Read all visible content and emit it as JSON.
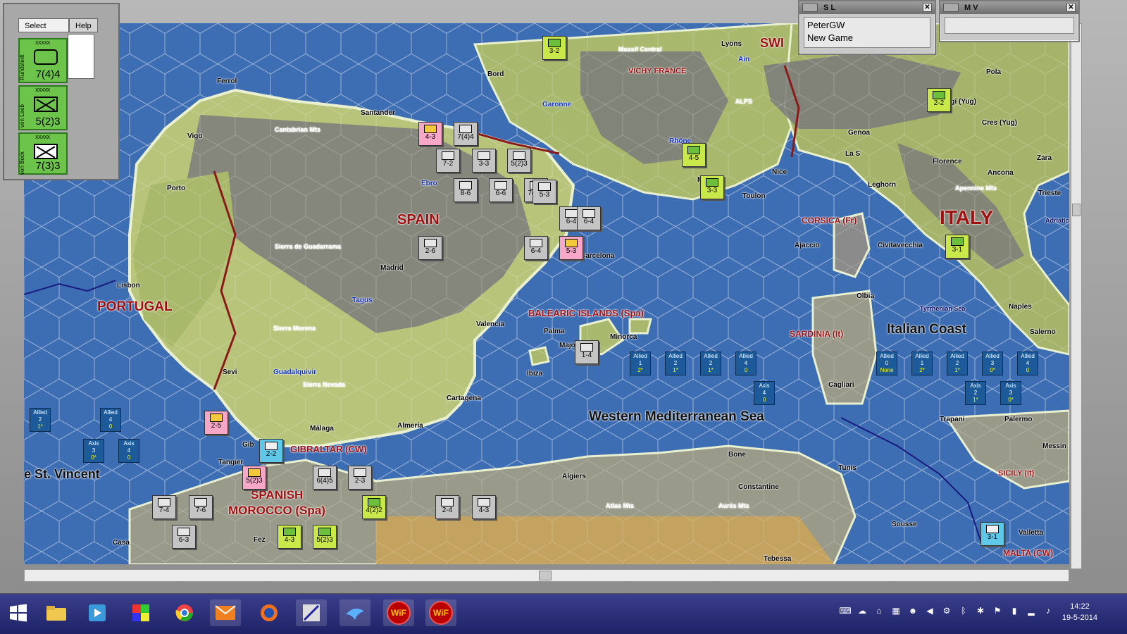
{
  "windows": {
    "select_panel": {
      "tabs": [
        "Select",
        "Help"
      ]
    },
    "sl": {
      "title": "S L",
      "player": "PeterGW",
      "status": "New Game"
    },
    "mv": {
      "title": "M V"
    }
  },
  "hq_cards": [
    {
      "label": "Rundstedt",
      "size": "XXXXX",
      "strength": "7(4)4",
      "symbol": "hq"
    },
    {
      "label": "von Leeb",
      "size": "XXXXX",
      "strength": "5(2)3",
      "symbol": "inf"
    },
    {
      "label": "von Bock",
      "size": "XXXXX",
      "strength": "7(3)3",
      "symbol": "inf"
    }
  ],
  "map": {
    "countries": [
      "SPAIN",
      "PORTUGAL",
      "ITALY",
      "VICHY FRANCE",
      "SWI"
    ],
    "regions": [
      "GIBRALTAR (CW)",
      "SPANISH",
      "MOROCCO (Spa)",
      "BALEARIC ISLANDS (Spa)",
      "CORSICA (Fr)",
      "SARDINIA (It)",
      "SICILY (It)",
      "MALTA (CW)"
    ],
    "seas": [
      "Western Mediterranean Sea",
      "Italian Coast",
      "e St. Vincent",
      "Tyrrhenian Sea",
      "Adriatic"
    ],
    "cities": [
      "Ferrol",
      "Santander",
      "Vigo",
      "Porto",
      "Lisbon",
      "Madrid",
      "Valencia",
      "Sevi",
      "Málaga",
      "Almería",
      "Cartagena",
      "Barcelona",
      "Palma",
      "Majorca",
      "Minorca",
      "Ibiza",
      "Bord",
      "Lyons",
      "Nice",
      "Toulon",
      "Marseill",
      "Genoa",
      "La S",
      "Leghorn",
      "Florence",
      "Ancona",
      "Zara",
      "Civitavecchia",
      "Ajaccio",
      "Olbia",
      "Cagliari",
      "Naples",
      "Salerno",
      "Trapani",
      "Palermo",
      "Messin",
      "Tangier",
      "Algiers",
      "Bone",
      "Constantine",
      "Tunis",
      "Sousse",
      "Tebessa",
      "Casa",
      "Fez",
      "Trieste",
      "Pola",
      "Dugi (Yug)",
      "Cres (Yug)",
      "Gib",
      "Valletta"
    ],
    "terrain": [
      "Cantabrian Mts",
      "Sierra de Guadarrama",
      "Sierra Morena",
      "Sierra Nevada",
      "Massif Central",
      "ALPS",
      "Apennine Mts",
      "Atlas Mts",
      "Aurès Mts"
    ],
    "rivers": [
      "Ebro",
      "Tagus",
      "Guadalquivir",
      "Garonne",
      "Rhône",
      "Ain"
    ],
    "units": [
      {
        "id": "u1",
        "val": "4-3",
        "color": "pink"
      },
      {
        "id": "u2",
        "val": "7(4)4",
        "color": "grey"
      },
      {
        "id": "u3",
        "val": "7-2",
        "color": "grey"
      },
      {
        "id": "u4",
        "val": "3-3",
        "color": "grey"
      },
      {
        "id": "u5",
        "val": "5(2)3",
        "color": "grey"
      },
      {
        "id": "u6",
        "val": "8-6",
        "color": "grey"
      },
      {
        "id": "u7",
        "val": "6-6",
        "color": "grey"
      },
      {
        "id": "u8",
        "val": "7(3)3",
        "color": "grey"
      },
      {
        "id": "u9",
        "val": "2-6",
        "color": "grey"
      },
      {
        "id": "u10",
        "val": "6-4",
        "color": "grey"
      },
      {
        "id": "u11",
        "val": "6-4",
        "color": "grey"
      },
      {
        "id": "u12",
        "val": "6-4",
        "color": "grey"
      },
      {
        "id": "u13",
        "val": "5-3",
        "color": "pink"
      },
      {
        "id": "u14",
        "val": "1-4",
        "color": "grey"
      },
      {
        "id": "u15",
        "val": "2-5",
        "color": "pink"
      },
      {
        "id": "u16",
        "val": "2-2",
        "color": "cyan"
      },
      {
        "id": "u17",
        "val": "5(2)3",
        "color": "pink"
      },
      {
        "id": "u18",
        "val": "6(4)5",
        "color": "grey"
      },
      {
        "id": "u19",
        "val": "2-3",
        "color": "grey"
      },
      {
        "id": "u20",
        "val": "7-4",
        "color": "grey"
      },
      {
        "id": "u21",
        "val": "7-6",
        "color": "grey"
      },
      {
        "id": "u22",
        "val": "6-3",
        "color": "grey"
      },
      {
        "id": "u23",
        "val": "4-3",
        "color": "green"
      },
      {
        "id": "u24",
        "val": "5(2)3",
        "color": "green"
      },
      {
        "id": "u25",
        "val": "4(2)2",
        "color": "green"
      },
      {
        "id": "u26",
        "val": "2-4",
        "color": "grey"
      },
      {
        "id": "u27",
        "val": "4-3",
        "color": "grey"
      },
      {
        "id": "u28",
        "val": "4-5",
        "color": "green"
      },
      {
        "id": "u29",
        "val": "3-3",
        "color": "green"
      },
      {
        "id": "u30",
        "val": "2-2",
        "color": "green"
      },
      {
        "id": "u31",
        "val": "3-1",
        "color": "green"
      },
      {
        "id": "u32",
        "val": "3-1",
        "color": "cyan"
      },
      {
        "id": "u33",
        "val": "5-3",
        "color": "grey"
      },
      {
        "id": "u34",
        "val": "3-2",
        "color": "green"
      }
    ],
    "boxes": [
      {
        "id": "b1",
        "side": "Allied",
        "v": "1",
        "s": "2*"
      },
      {
        "id": "b2",
        "side": "Allied",
        "v": "2",
        "s": "1*"
      },
      {
        "id": "b3",
        "side": "Allied",
        "v": "2",
        "s": "1*"
      },
      {
        "id": "b4",
        "side": "Allied",
        "v": "4",
        "s": "0"
      },
      {
        "id": "b5",
        "side": "Axis",
        "v": "4",
        "s": "0"
      },
      {
        "id": "b6",
        "side": "Allied",
        "v": "0",
        "s": "None"
      },
      {
        "id": "b7",
        "side": "Allied",
        "v": "1",
        "s": "2*"
      },
      {
        "id": "b8",
        "side": "Allied",
        "v": "2",
        "s": "1*"
      },
      {
        "id": "b9",
        "side": "Allied",
        "v": "3",
        "s": "0*"
      },
      {
        "id": "b10",
        "side": "Allied",
        "v": "4",
        "s": "0"
      },
      {
        "id": "b11",
        "side": "Axis",
        "v": "2",
        "s": "1*"
      },
      {
        "id": "b12",
        "side": "Axis",
        "v": "3",
        "s": "0*"
      },
      {
        "id": "b13",
        "side": "Allied",
        "v": "2",
        "s": "1*"
      },
      {
        "id": "b14",
        "side": "Allied",
        "v": "4",
        "s": "0"
      },
      {
        "id": "b15",
        "side": "Axis",
        "v": "3",
        "s": "0*"
      },
      {
        "id": "b16",
        "side": "Axis",
        "v": "4",
        "s": "0"
      }
    ]
  },
  "taskbar": {
    "clock_time": "14:22",
    "clock_date": "19-5-2014",
    "apps": [
      "start",
      "explorer",
      "media",
      "app3",
      "chrome",
      "mail",
      "firefox",
      "app7",
      "app8",
      "WiF",
      "WiF"
    ]
  }
}
